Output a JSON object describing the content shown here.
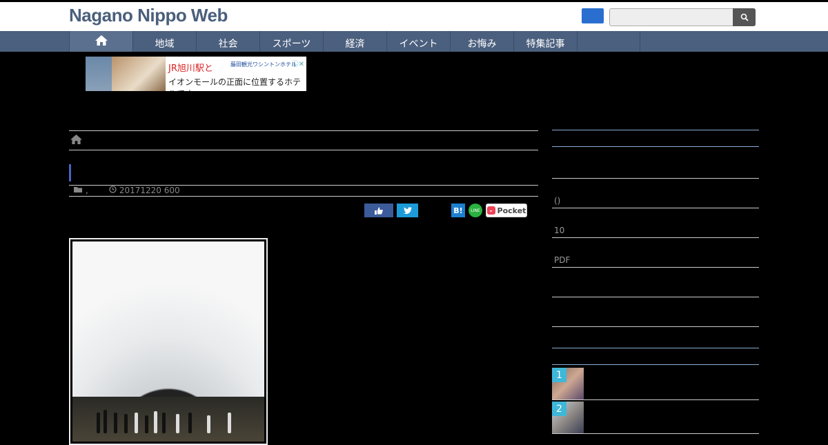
{
  "header": {
    "site_title": "Nagano Nippo Web",
    "search": {
      "placeholder": ""
    }
  },
  "nav": {
    "items": [
      {
        "label": ""
      },
      {
        "label": "地域"
      },
      {
        "label": "社会"
      },
      {
        "label": "スポーツ"
      },
      {
        "label": "経済"
      },
      {
        "label": "イベント"
      },
      {
        "label": "お悔み"
      },
      {
        "label": "特集記事"
      }
    ]
  },
  "ad": {
    "line1": "JR旭川駅と",
    "line2": "イオンモールの正面に位置するホテルです。",
    "brand": "藤田観光ワシントンホテル"
  },
  "article": {
    "categories": ",",
    "date": "20171220 600"
  },
  "share": {
    "hatena_label": "B!",
    "line_label": "LINE",
    "pocket_label": "Pocket"
  },
  "sidebar": {
    "items": [
      {
        "label": "()"
      },
      {
        "label": "10"
      },
      {
        "label": "PDF"
      }
    ],
    "ranking": [
      {
        "rank": "1"
      },
      {
        "rank": "2"
      }
    ]
  },
  "colors": {
    "nav_bg": "#4b5f7e",
    "accent_blue": "#4a63c4",
    "facebook": "#3b5b9a",
    "twitter": "#1d9bd9",
    "line": "#2bb13f",
    "pocket": "#ee4256",
    "rank_badge": "#3fb7d8"
  }
}
